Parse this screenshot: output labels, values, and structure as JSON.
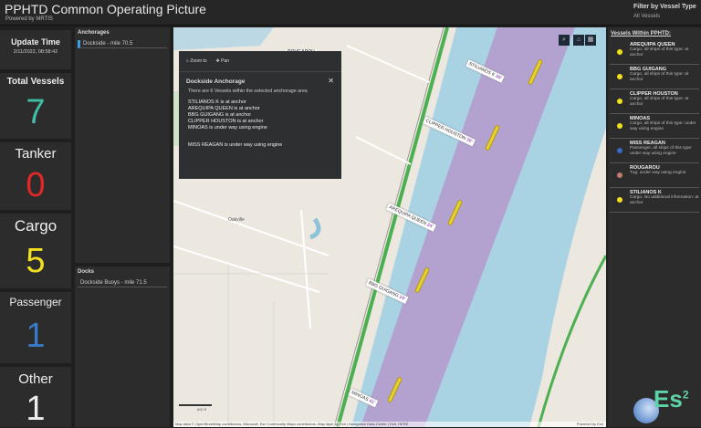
{
  "header": {
    "title": "PPHTD Common Operating Picture",
    "subtitle": "Powered by MRTIS",
    "filter_label": "Filter by Vessel Type",
    "filter_value": "All Vessels"
  },
  "tiles": {
    "update": {
      "label": "Update Time",
      "value": "2/11/2022, 08:58:42"
    },
    "total": {
      "label": "Total Vessels",
      "value": "7",
      "color": "#3fbfa6"
    },
    "tanker": {
      "label": "Tanker",
      "value": "0",
      "color": "#e02828"
    },
    "cargo": {
      "label": "Cargo",
      "value": "5",
      "color": "#f0e020"
    },
    "passenger": {
      "label": "Passenger",
      "value": "1",
      "color": "#3a78c8"
    },
    "other": {
      "label": "Other",
      "value": "1",
      "color": "#eeeeee"
    }
  },
  "anchorages": {
    "title": "Anchorages",
    "items": [
      "Dockside - mile 70.5"
    ]
  },
  "docks": {
    "title": "Docks",
    "items": [
      "Dockside Buoys - mile 71.5"
    ]
  },
  "popup": {
    "zoom": "Zoom to",
    "pan": "Pan",
    "title": "Dockside Anchorage",
    "intro": "There are 6 Vessels within the selected anchorage area",
    "lines": [
      "STILIANOS K is at anchor",
      "AREQUIPA QUEEN is at anchor",
      "BBG GUIGANG is at anchor",
      "CLIPPER HOUSTON is at anchor",
      "MINOAS is under way using engine"
    ],
    "extra": "MISS REAGAN is under way using engine"
  },
  "map": {
    "labels": [
      {
        "name": "STILIANOS K",
        "draft": "29'"
      },
      {
        "name": "CLIPPER HOUSTON",
        "draft": "30'"
      },
      {
        "name": "AREQUIPA QUEEN",
        "draft": "24'"
      },
      {
        "name": "BBG GUIGANG",
        "draft": "24'"
      },
      {
        "name": "MINOAS",
        "draft": "41'"
      }
    ],
    "rougarou": "ROUGAROU",
    "town": "Oakville",
    "scale": "600 ft",
    "attribution": "Map data © OpenStreetMap contributors, Microsoft, Esri Community Maps contributors, Map layer by Esri | Navigation Data Center | Esri, HERE",
    "powered": "Powered by Esri"
  },
  "vessels": {
    "title": "Vessels Within PPHTD:",
    "items": [
      {
        "name": "AREQUIPA QUEEN",
        "desc": "Cargo, all ships of this type:  at anchor",
        "color": "#f0e020"
      },
      {
        "name": "BBG GUIGANG",
        "desc": "Cargo, all ships of this type:  at anchor",
        "color": "#f0e020"
      },
      {
        "name": "CLIPPER HOUSTON",
        "desc": "Cargo, all ships of this type:  at anchor",
        "color": "#f0e020"
      },
      {
        "name": "MINOAS",
        "desc": "Cargo, all ships of this type: under way using engine",
        "color": "#f0e020"
      },
      {
        "name": "MISS REAGAN",
        "desc": "Passenger, all ships of this type: under way using engine",
        "color": "#3a68c0"
      },
      {
        "name": "ROUGAROU",
        "desc": "Tug:  under way using engine",
        "color": "#c08070"
      },
      {
        "name": "STILIANOS K",
        "desc": "Cargo, No additional information:  at anchor",
        "color": "#f0e020"
      }
    ]
  },
  "logo": "Es²"
}
